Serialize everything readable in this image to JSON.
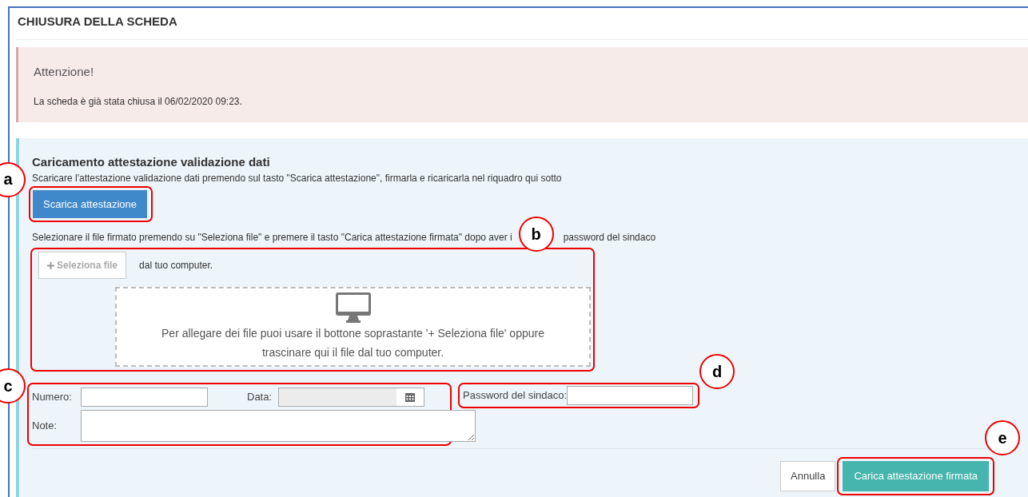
{
  "title": "CHIUSURA DELLA SCHEDA",
  "alert": {
    "heading": "Attenzione!",
    "message": "La scheda è già stata chiusa il 06/02/2020 09:23."
  },
  "upload": {
    "heading": "Caricamento attestazione validazione dati",
    "instruction": "Scaricare l'attestazione validazione dati premendo sul tasto \"Scarica attestazione\", firmarla e ricaricarla nel riquadro qui sotto",
    "download_button": "Scarica attestazione",
    "select_instruction": [
      "Selezionare il file firmato premendo su \"Seleziona file\" e premere il tasto \"Carica attestazione firmata\" dopo aver i",
      "password del sindaco"
    ],
    "select_button": "Seleziona file",
    "select_hint": "dal tuo computer.",
    "dropzone_text": "Per allegare dei file puoi usare il bottone soprastante '+ Seleziona file' oppure trascinare qui il file dal tuo computer."
  },
  "fields": [
    {
      "label": "Numero:",
      "kind": "text",
      "disabled": false
    },
    {
      "label": "Data:",
      "kind": "date",
      "disabled": true
    },
    {
      "label": "Password del sindaco:",
      "kind": "password",
      "disabled": false
    },
    {
      "label": "Note:",
      "kind": "textarea",
      "disabled": false
    }
  ],
  "buttons": {
    "cancel": "Annulla",
    "submit": "Carica attestazione firmata"
  },
  "callouts": [
    "a",
    "b",
    "c",
    "d",
    "e"
  ]
}
